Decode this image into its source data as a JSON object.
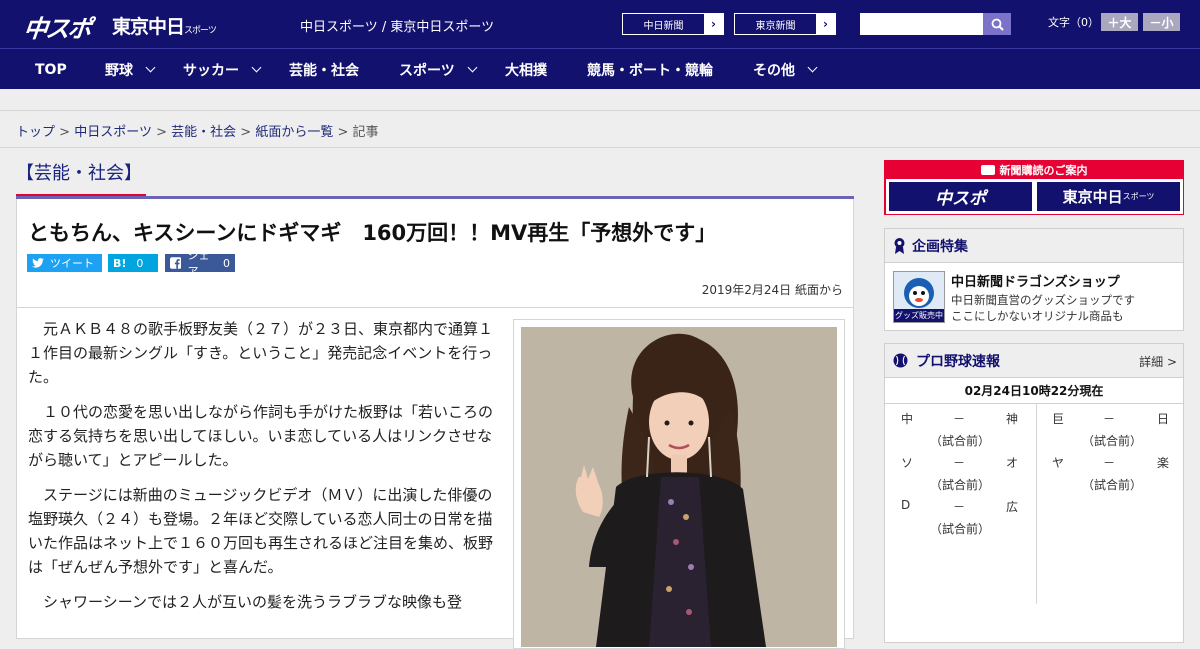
{
  "header": {
    "logo_chuspo": "中スポ",
    "logo_tokyo": "東京中日",
    "logo_tokyo_sub": "スポーツ",
    "site_name": "中日スポーツ / 東京中日スポーツ",
    "links": [
      {
        "label": "中日新聞",
        "arrow": "›"
      },
      {
        "label": "東京新聞",
        "arrow": "›"
      }
    ],
    "search": {
      "value": "",
      "placeholder": "",
      "icon": "search-icon"
    },
    "font_size_label": "文字（0）",
    "font_larger": "＋大",
    "font_smaller": "－小"
  },
  "nav": {
    "items": [
      {
        "label": "TOP",
        "dropdown": false
      },
      {
        "label": "野球",
        "dropdown": true
      },
      {
        "label": "サッカー",
        "dropdown": true
      },
      {
        "label": "芸能・社会",
        "dropdown": false
      },
      {
        "label": "スポーツ",
        "dropdown": true
      },
      {
        "label": "大相撲",
        "dropdown": false
      },
      {
        "label": "競馬・ボート・競輪",
        "dropdown": false
      },
      {
        "label": "その他",
        "dropdown": true
      }
    ]
  },
  "breadcrumb": {
    "items": [
      "トップ",
      "中日スポーツ",
      "芸能・社会",
      "紙面から一覧"
    ],
    "separator": ">",
    "current": "記事"
  },
  "category": {
    "title": "【芸能・社会】"
  },
  "article": {
    "headline": "ともちん、キスシーンにドギマギ　160万回！！MV再生「予想外です」",
    "share": {
      "tweet": "ツイート",
      "hatena_label": "B!",
      "hatena_count": "0",
      "facebook_label": "シェア",
      "facebook_count": "0"
    },
    "date": "2019年2月24日 紙面から",
    "paragraphs": [
      "元ＡＫＢ４８の歌手板野友美（２７）が２３日、東京都内で通算１１作目の最新シングル「すき。ということ」発売記念イベントを行った。",
      "１０代の恋愛を思い出しながら作詞も手がけた板野は「若いころの恋する気持ちを思い出してほしい。いま恋している人はリンクさせながら聴いて」とアピールした。",
      "ステージには新曲のミュージックビデオ（ＭＶ）に出演した俳優の塩野瑛久（２４）も登場。２年ほど交際している恋人同士の日常を描いた作品はネット上で１６０万回も再生されるほど注目を集め、板野は「ぜんぜん予想外です」と喜んだ。",
      "シャワーシーンでは２人が互いの髪を洗うラブラブな映像も登"
    ]
  },
  "sidebar": {
    "subscribe": {
      "title": "新聞購読のご案内",
      "logo_chuspo": "中スポ",
      "logo_tokyo": "東京中日",
      "logo_tokyo_sub": "スポーツ"
    },
    "feature": {
      "heading": "企画特集",
      "item_title": "中日新聞ドラゴンズショップ",
      "item_desc1": "中日新聞直営のグッズショップです",
      "item_desc2": "ここにしかないオリジナル商品も",
      "thumb_label": "グッズ販売中"
    },
    "baseball": {
      "heading": "プロ野球速報",
      "detail_link": "詳細 >",
      "updated": "02月24日10時22分現在",
      "games": [
        {
          "home": "中",
          "score": "－",
          "away": "神",
          "status": "（試合前）"
        },
        {
          "home": "巨",
          "score": "－",
          "away": "日",
          "status": "（試合前）"
        },
        {
          "home": "ソ",
          "score": "－",
          "away": "オ",
          "status": "（試合前）"
        },
        {
          "home": "ヤ",
          "score": "－",
          "away": "楽",
          "status": "（試合前）"
        },
        {
          "home": "D",
          "score": "－",
          "away": "広",
          "status": "（試合前）"
        }
      ]
    }
  },
  "colors": {
    "brand_navy": "#13116e",
    "accent_red": "#e60033",
    "twitter": "#1da1f2",
    "hatena": "#00a4de",
    "facebook": "#3b5998"
  }
}
